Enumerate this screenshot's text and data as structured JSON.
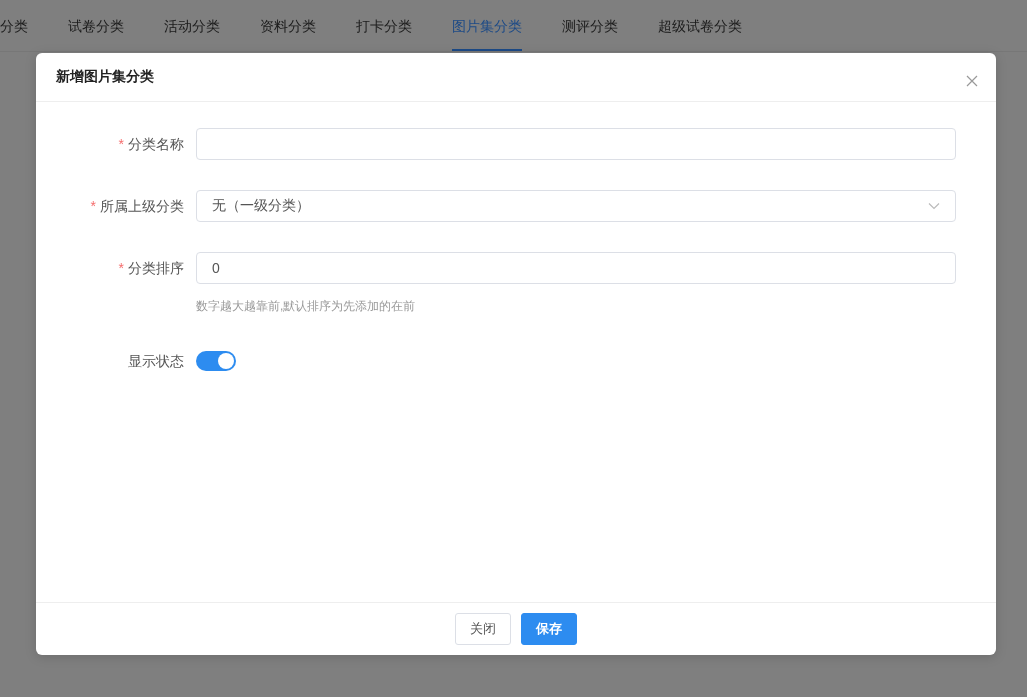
{
  "tabs": [
    {
      "label": "分类",
      "selected": false
    },
    {
      "label": "试卷分类",
      "selected": false
    },
    {
      "label": "活动分类",
      "selected": false
    },
    {
      "label": "资料分类",
      "selected": false
    },
    {
      "label": "打卡分类",
      "selected": false
    },
    {
      "label": "图片集分类",
      "selected": true
    },
    {
      "label": "测评分类",
      "selected": false
    },
    {
      "label": "超级试卷分类",
      "selected": false
    }
  ],
  "dialog": {
    "title": "新增图片集分类",
    "fields": [
      {
        "kind": "text",
        "label": "分类名称",
        "required_mark": "*"
      },
      {
        "kind": "select",
        "label": "所属上级分类",
        "required_mark": "*",
        "value": "无（一级分类）"
      },
      {
        "kind": "text",
        "label": "分类排序",
        "required_mark": "*",
        "value": "0",
        "hint": "数字越大越靠前,默认排序为先添加的在前"
      },
      {
        "kind": "switch",
        "label": "显示状态",
        "on": true
      }
    ],
    "buttons": [
      {
        "label": "关闭",
        "kind": "default"
      },
      {
        "label": "保存",
        "kind": "primary"
      }
    ]
  }
}
